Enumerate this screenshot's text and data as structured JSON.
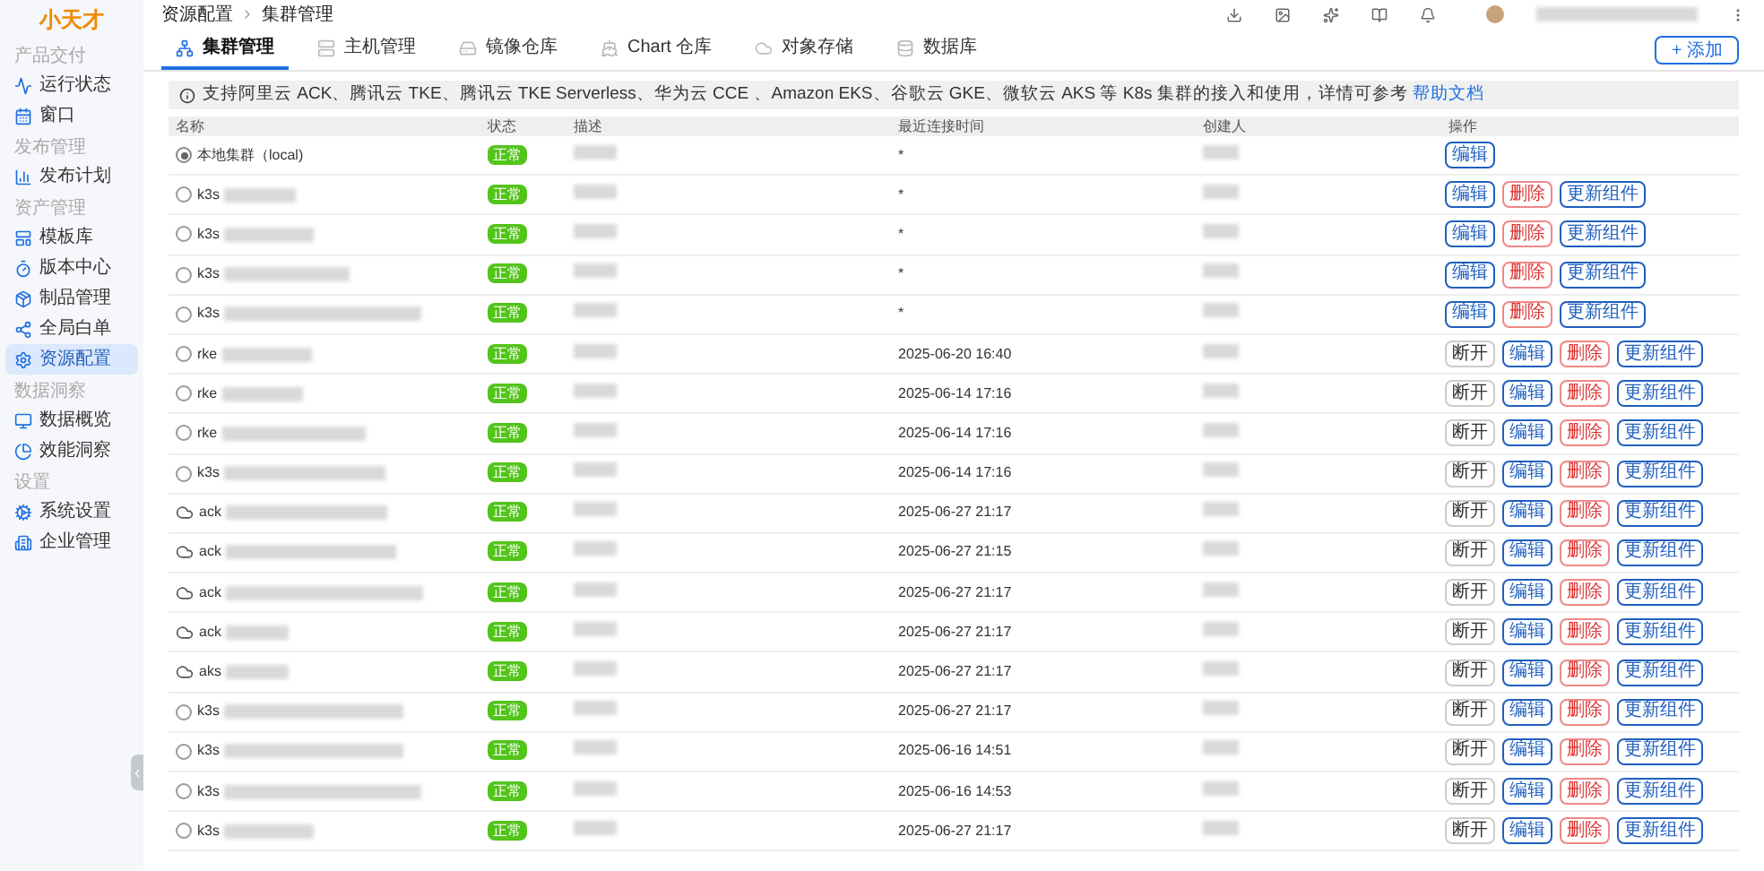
{
  "logo": {
    "text": "小天才"
  },
  "sidebar": {
    "sections": [
      {
        "title": "产品交付",
        "items": [
          {
            "label": "运行状态",
            "selected": false
          },
          {
            "label": "窗口",
            "selected": false
          }
        ]
      },
      {
        "title": "发布管理",
        "items": [
          {
            "label": "发布计划",
            "selected": false
          }
        ]
      },
      {
        "title": "资产管理",
        "items": [
          {
            "label": "模板库",
            "selected": false
          },
          {
            "label": "版本中心",
            "selected": false
          },
          {
            "label": "制品管理",
            "selected": false
          },
          {
            "label": "全局白单",
            "selected": false
          },
          {
            "label": "资源配置",
            "selected": true
          }
        ]
      },
      {
        "title": "数据洞察",
        "items": [
          {
            "label": "数据概览",
            "selected": false
          },
          {
            "label": "效能洞察",
            "selected": false
          }
        ]
      },
      {
        "title": "设置",
        "items": [
          {
            "label": "系统设置",
            "selected": false
          },
          {
            "label": "企业管理",
            "selected": false
          }
        ]
      }
    ]
  },
  "breadcrumb": [
    "资源配置",
    "集群管理"
  ],
  "tabs": [
    {
      "label": "集群管理",
      "selected": true
    },
    {
      "label": "主机管理",
      "selected": false
    },
    {
      "label": "镜像仓库",
      "selected": false
    },
    {
      "label": "Chart 仓库",
      "selected": false
    },
    {
      "label": "对象存储",
      "selected": false
    },
    {
      "label": "数据库",
      "selected": false
    }
  ],
  "add_button": "+ 添加",
  "notice": {
    "text": "支持阿里云 ACK、腾讯云 TKE、腾讯云 TKE Serverless、华为云 CCE 、Amazon EKS、谷歌云 GKE、微软云 AKS 等 K8s 集群的接入和使用，详情可参考",
    "link": "帮助文档"
  },
  "table": {
    "columns": [
      "名称",
      "状态",
      "描述",
      "最近连接时间",
      "创建人",
      "操作"
    ],
    "rows": [
      {
        "kind": "local",
        "name": "本地集群（local)",
        "status": "正常",
        "last_connected": "*",
        "actions": [
          "编辑"
        ]
      },
      {
        "kind": "cluster",
        "name": "k3s",
        "status": "正常",
        "last_connected": "*",
        "actions": [
          "编辑",
          "删除",
          "更新组件"
        ]
      },
      {
        "kind": "cluster",
        "name": "k3s",
        "status": "正常",
        "last_connected": "*",
        "actions": [
          "编辑",
          "删除",
          "更新组件"
        ]
      },
      {
        "kind": "cluster",
        "name": "k3s",
        "status": "正常",
        "last_connected": "*",
        "actions": [
          "编辑",
          "删除",
          "更新组件"
        ]
      },
      {
        "kind": "cluster",
        "name": "k3s",
        "status": "正常",
        "last_connected": "*",
        "actions": [
          "编辑",
          "删除",
          "更新组件"
        ]
      },
      {
        "kind": "cluster",
        "name": "rke",
        "status": "正常",
        "last_connected": "2025-06-20 16:40",
        "actions": [
          "断开",
          "编辑",
          "删除",
          "更新组件"
        ]
      },
      {
        "kind": "cluster",
        "name": "rke",
        "status": "正常",
        "last_connected": "2025-06-14 17:16",
        "actions": [
          "断开",
          "编辑",
          "删除",
          "更新组件"
        ]
      },
      {
        "kind": "cluster",
        "name": "rke",
        "status": "正常",
        "last_connected": "2025-06-14 17:16",
        "actions": [
          "断开",
          "编辑",
          "删除",
          "更新组件"
        ]
      },
      {
        "kind": "cluster",
        "name": "k3s",
        "status": "正常",
        "last_connected": "2025-06-14 17:16",
        "actions": [
          "断开",
          "编辑",
          "删除",
          "更新组件"
        ]
      },
      {
        "kind": "cloud",
        "name": "ack",
        "status": "正常",
        "last_connected": "2025-06-27 21:17",
        "actions": [
          "断开",
          "编辑",
          "删除",
          "更新组件"
        ]
      },
      {
        "kind": "cloud",
        "name": "ack",
        "status": "正常",
        "last_connected": "2025-06-27 21:15",
        "actions": [
          "断开",
          "编辑",
          "删除",
          "更新组件"
        ]
      },
      {
        "kind": "cloud",
        "name": "ack",
        "status": "正常",
        "last_connected": "2025-06-27 21:17",
        "actions": [
          "断开",
          "编辑",
          "删除",
          "更新组件"
        ]
      },
      {
        "kind": "cloud",
        "name": "ack",
        "status": "正常",
        "last_connected": "2025-06-27 21:17",
        "actions": [
          "断开",
          "编辑",
          "删除",
          "更新组件"
        ]
      },
      {
        "kind": "cloud",
        "name": "aks",
        "status": "正常",
        "last_connected": "2025-06-27 21:17",
        "actions": [
          "断开",
          "编辑",
          "删除",
          "更新组件"
        ]
      },
      {
        "kind": "cluster",
        "name": "k3s",
        "status": "正常",
        "last_connected": "2025-06-27 21:17",
        "actions": [
          "断开",
          "编辑",
          "删除",
          "更新组件"
        ]
      },
      {
        "kind": "cluster",
        "name": "k3s",
        "status": "正常",
        "last_connected": "2025-06-16 14:51",
        "actions": [
          "断开",
          "编辑",
          "删除",
          "更新组件"
        ]
      },
      {
        "kind": "cluster",
        "name": "k3s",
        "status": "正常",
        "last_connected": "2025-06-16 14:53",
        "actions": [
          "断开",
          "编辑",
          "删除",
          "更新组件"
        ]
      },
      {
        "kind": "cluster",
        "name": "k3s",
        "status": "正常",
        "last_connected": "2025-06-27 21:17",
        "actions": [
          "断开",
          "编辑",
          "删除",
          "更新组件"
        ]
      }
    ]
  }
}
